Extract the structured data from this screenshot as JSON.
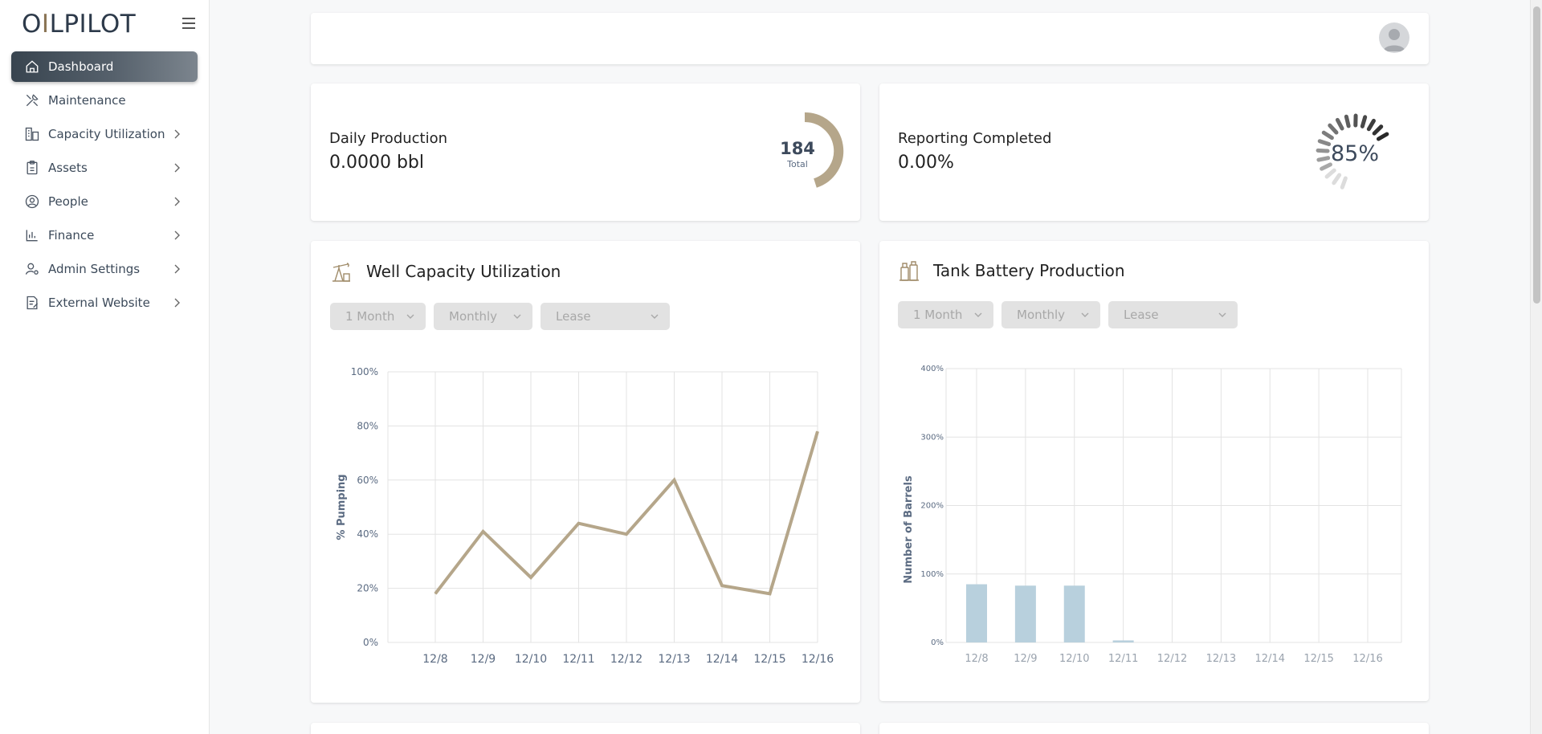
{
  "app": {
    "logo_text_a": "O",
    "logo_text_b": "LPILOT"
  },
  "sidebar": {
    "items": [
      {
        "label": "Dashboard",
        "icon": "home-icon",
        "active": true,
        "expandable": false
      },
      {
        "label": "Maintenance",
        "icon": "tools-icon",
        "active": false,
        "expandable": false
      },
      {
        "label": "Capacity Utilization",
        "icon": "building-icon",
        "active": false,
        "expandable": true
      },
      {
        "label": "Assets",
        "icon": "clipboard-icon",
        "active": false,
        "expandable": true
      },
      {
        "label": "People",
        "icon": "user-circle-icon",
        "active": false,
        "expandable": true
      },
      {
        "label": "Finance",
        "icon": "bar-chart-icon",
        "active": false,
        "expandable": true
      },
      {
        "label": "Admin Settings",
        "icon": "user-gear-icon",
        "active": false,
        "expandable": true
      },
      {
        "label": "External Website",
        "icon": "document-edit-icon",
        "active": false,
        "expandable": true
      }
    ]
  },
  "daily_production": {
    "label": "Daily Production",
    "value": "0.0000 bbl",
    "gauge_value": "184",
    "gauge_caption": "Total"
  },
  "reporting": {
    "label": "Reporting Completed",
    "value": "0.00%",
    "gauge_percent_label": "85%",
    "gauge_percent": 85
  },
  "well_capacity": {
    "title": "Well Capacity Utilization",
    "filters": {
      "period": "1 Month",
      "frequency": "Monthly",
      "lease": "Lease"
    }
  },
  "tank_battery": {
    "title": "Tank Battery Production",
    "filters": {
      "period": "1 Month",
      "frequency": "Monthly",
      "lease": "Lease"
    }
  },
  "colors": {
    "line": "#b5a68a",
    "bar": "#b8d0dd",
    "active_nav": "#3c4854"
  },
  "chart_data": [
    {
      "type": "line",
      "x": [
        "12/8",
        "12/9",
        "12/10",
        "12/11",
        "12/12",
        "12/13",
        "12/14",
        "12/15",
        "12/16"
      ],
      "series": [
        {
          "values": [
            18,
            41,
            24,
            44,
            40,
            60,
            21,
            18,
            78
          ]
        }
      ],
      "xlabel": "",
      "ylabel": "% Pumping",
      "yticks": [
        "0%",
        "20%",
        "40%",
        "60%",
        "80%",
        "100%"
      ],
      "ylim": [
        0,
        100
      ],
      "grid": true
    },
    {
      "type": "bar",
      "categories": [
        "12/8",
        "12/9",
        "12/10",
        "12/11",
        "12/12",
        "12/13",
        "12/14",
        "12/15",
        "12/16"
      ],
      "values": [
        85,
        83,
        83,
        3,
        0,
        0,
        0,
        0,
        0
      ],
      "xlabel": "",
      "ylabel": "Number of Barrels",
      "yticks": [
        "0%",
        "100%",
        "200%",
        "300%",
        "400%"
      ],
      "ylim": [
        0,
        400
      ],
      "grid": true
    }
  ]
}
